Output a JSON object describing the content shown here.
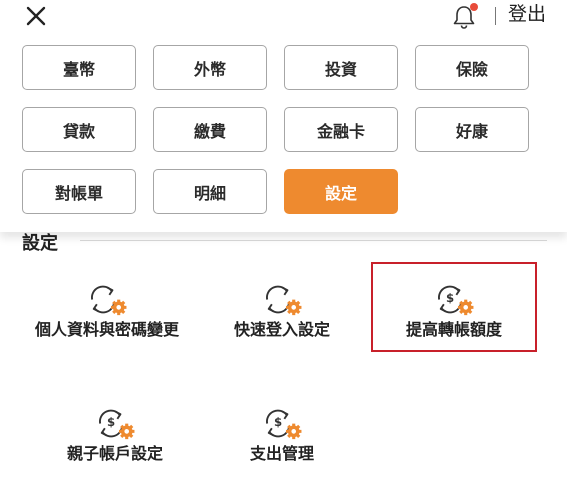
{
  "header": {
    "logout_label": "登出",
    "notification_dot_color": "#e84b3a"
  },
  "menu": {
    "items": [
      {
        "label": "臺幣",
        "active": false
      },
      {
        "label": "外幣",
        "active": false
      },
      {
        "label": "投資",
        "active": false
      },
      {
        "label": "保險",
        "active": false
      },
      {
        "label": "貸款",
        "active": false
      },
      {
        "label": "繳費",
        "active": false
      },
      {
        "label": "金融卡",
        "active": false
      },
      {
        "label": "好康",
        "active": false
      },
      {
        "label": "對帳單",
        "active": false
      },
      {
        "label": "明細",
        "active": false
      },
      {
        "label": "設定",
        "active": true
      }
    ],
    "active_color": "#ee8a2f"
  },
  "settings": {
    "title": "設定",
    "tiles": [
      {
        "label": "個人資料與密碼變更",
        "icon": "sync-gear-icon"
      },
      {
        "label": "快速登入設定",
        "icon": "sync-gear-icon"
      },
      {
        "label": "提高轉帳額度",
        "icon": "sync-dollar-gear-icon",
        "highlighted": true
      },
      {
        "label": "親子帳戶設定",
        "icon": "sync-dollar-gear-icon"
      },
      {
        "label": "支出管理",
        "icon": "sync-dollar-gear-icon"
      }
    ],
    "highlight_color": "#c8202a"
  }
}
